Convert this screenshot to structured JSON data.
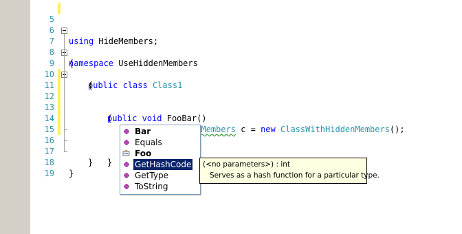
{
  "editor": {
    "lines": [
      {
        "num": "5",
        "text_kw": "using",
        "text_rest": " HideMembers;"
      },
      {
        "num": "6"
      },
      {
        "num": "7",
        "text_kw": "namespace",
        "text_rest": " UseHiddenMembers"
      },
      {
        "num": "8",
        "text": "{"
      },
      {
        "num": "9",
        "kw1": "public",
        "kw2": "class",
        "type": "Class1"
      },
      {
        "num": "10",
        "text": "{"
      },
      {
        "num": "11",
        "kw1": "public",
        "kw2": "void",
        "rest": " FooBar()"
      },
      {
        "num": "12",
        "text": "{"
      },
      {
        "num": "13",
        "type1": "ClassWithHiddenMembers",
        "mid": " c = ",
        "kw": "new",
        "type2": "ClassWithHiddenMembers",
        "end": "();"
      },
      {
        "num": "14"
      },
      {
        "num": "15",
        "text": "c."
      },
      {
        "num": "16",
        "text": "}"
      },
      {
        "num": "17",
        "text": "}"
      },
      {
        "num": "18",
        "text": "}"
      },
      {
        "num": "19"
      }
    ]
  },
  "intellisense": {
    "items": [
      {
        "label": "Bar",
        "icon": "method-icon",
        "bold": true
      },
      {
        "label": "Equals",
        "icon": "method-icon",
        "bold": false
      },
      {
        "label": "Foo",
        "icon": "property-icon",
        "bold": true
      },
      {
        "label": "GetHashCode",
        "icon": "method-icon",
        "bold": false,
        "selected": true
      },
      {
        "label": "GetType",
        "icon": "method-icon",
        "bold": false
      },
      {
        "label": "ToString",
        "icon": "method-icon",
        "bold": false
      }
    ]
  },
  "tooltip": {
    "signature": "(<no parameters>) : int",
    "description": "Serves as a hash function for a particular type."
  },
  "colors": {
    "keyword": "#0000ff",
    "type": "#2b91af",
    "line_number": "#2b91af",
    "change_bar": "#ffee62",
    "selection": "#0a246a",
    "method_icon": "#c040c0",
    "tooltip_bg": "#ffffe1"
  }
}
